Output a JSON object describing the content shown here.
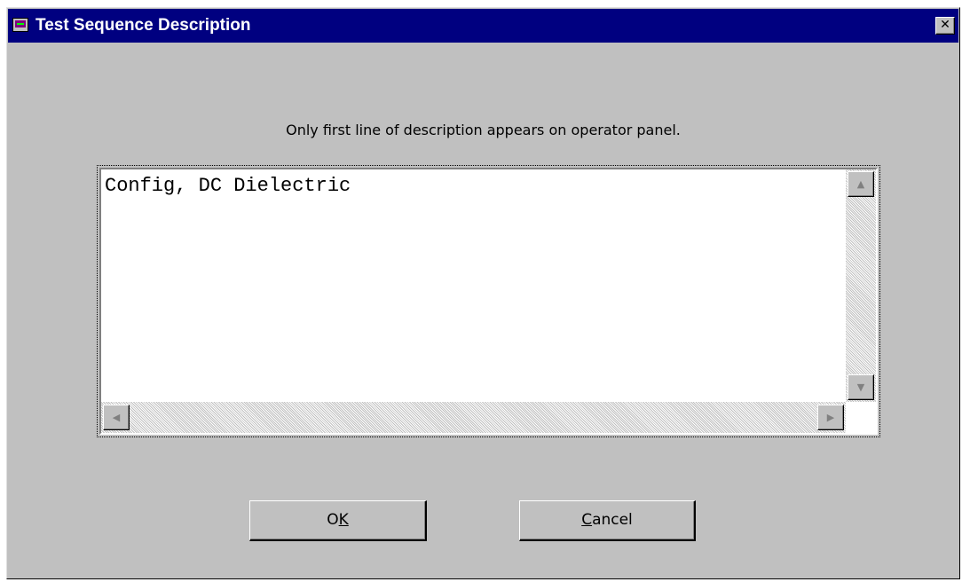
{
  "window": {
    "title": "Test Sequence Description",
    "close_symbol": "✕"
  },
  "dialog": {
    "hint": "Only first line of description appears on operator panel.",
    "description_text": "Config, DC Dielectric"
  },
  "scrollbars": {
    "up_icon": "scroll-up-arrow",
    "down_icon": "scroll-down-arrow",
    "left_icon": "scroll-left-arrow",
    "right_icon": "scroll-right-arrow"
  },
  "buttons": {
    "ok": {
      "label": "OK",
      "mnemonic": "K"
    },
    "cancel": {
      "label": "Cancel",
      "mnemonic": "C"
    }
  }
}
